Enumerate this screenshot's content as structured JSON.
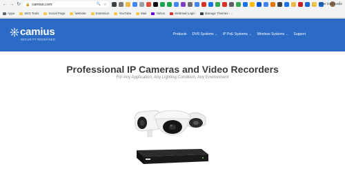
{
  "browser": {
    "nav_buttons": [
      "←",
      "→",
      "↻",
      "⌂"
    ],
    "url": "camius.com",
    "icons": [
      "lock-icon",
      "zoom-icon",
      "star-icon"
    ],
    "extension_colors": [
      "#3c4043",
      "#7a7a7a",
      "#e8b84a",
      "#4285f4",
      "#9aa0a6",
      "#e34e3a",
      "#111111",
      "#1aa34a",
      "#1aa34a",
      "#4285f4",
      "#7b3fbf",
      "#6f6f6f",
      "#4285f4",
      "#d93025",
      "#1a73e8",
      "#34a853",
      "#d93025",
      "#5f6368",
      "#34a853",
      "#1a73e8",
      "#fbbc04",
      "#0b57d0",
      "#4285f4",
      "#e37400",
      "#3c4043",
      "#1a73e8",
      "#e8b84a",
      "#c5221f",
      "#1967d2",
      "#e8b84a",
      "#1967d2"
    ],
    "menu_label": "⋮"
  },
  "bookmarks": {
    "items": [
      {
        "label": "Apps",
        "color": "#5f6368"
      },
      {
        "label": "SEO Tools",
        "color": "#f2c94c"
      },
      {
        "label": "Social Page",
        "color": "#f2c94c"
      },
      {
        "label": "Website",
        "color": "#f2c94c"
      },
      {
        "label": "Extension",
        "color": "#f2c94c"
      },
      {
        "label": "YouTube",
        "color": "#f2c94c"
      },
      {
        "label": "Mail",
        "color": "#f2c94c"
      },
      {
        "label": "Yahoo",
        "color": "#6001d2"
      },
      {
        "label": "Webmail Login",
        "color": "#d93025"
      },
      {
        "label": "Manage Themes -...",
        "color": "#3c4043"
      }
    ],
    "right_label": "Other bookmarks"
  },
  "site": {
    "logo_text": "camius",
    "tagline": "SECURITY REDEFINED",
    "nav": [
      {
        "label": "Products",
        "dropdown": false
      },
      {
        "label": "DVR Systems",
        "dropdown": true
      },
      {
        "label": "IP PoE Systems",
        "dropdown": true
      },
      {
        "label": "Wireless Systems",
        "dropdown": true
      },
      {
        "label": "Support",
        "dropdown": false
      }
    ],
    "caret": "⌄",
    "header_color": "#2b6bc6"
  },
  "hero": {
    "title": "Professional IP Cameras and Video Recorders",
    "subtitle": "For Any Application, Any Lighting Condition, Any Environment"
  }
}
